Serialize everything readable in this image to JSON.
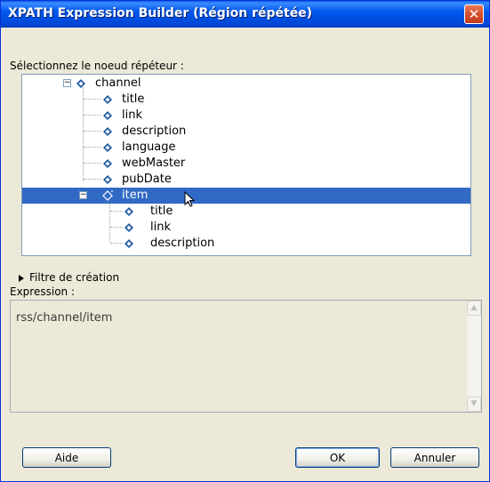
{
  "window": {
    "title": "XPATH Expression Builder (Région répétée)",
    "close_icon": "close-icon"
  },
  "tree": {
    "label": "Sélectionnez le noeud répéteur :",
    "nodes": [
      {
        "label": "channel"
      },
      {
        "label": "title"
      },
      {
        "label": "link"
      },
      {
        "label": "description"
      },
      {
        "label": "language"
      },
      {
        "label": "webMaster"
      },
      {
        "label": "pubDate"
      },
      {
        "label": "item"
      },
      {
        "label": "title"
      },
      {
        "label": "link"
      },
      {
        "label": "description"
      }
    ],
    "selected_index": 7
  },
  "filter": {
    "label": "Filtre de création"
  },
  "expression": {
    "label": "Expression :",
    "value": "rss/channel/item"
  },
  "buttons": {
    "help": "Aide",
    "ok": "OK",
    "cancel": "Annuler"
  },
  "colors": {
    "titlebar": "#0058ee",
    "selection": "#316ac5",
    "node_icon": "#1e5aa8"
  }
}
